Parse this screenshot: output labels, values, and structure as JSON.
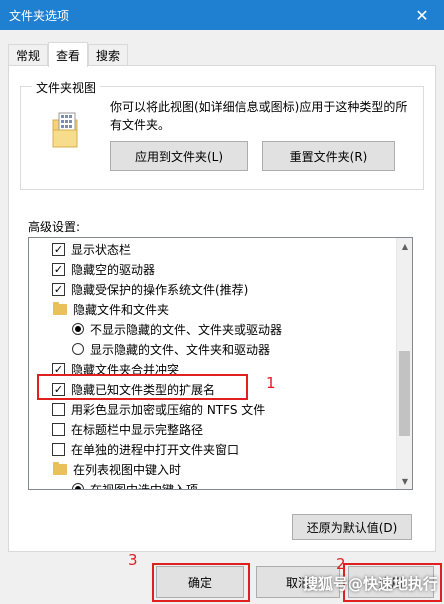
{
  "window": {
    "title": "文件夹选项",
    "close_symbol": "✕"
  },
  "tabs": [
    {
      "label": "常规",
      "active": false
    },
    {
      "label": "查看",
      "active": true
    },
    {
      "label": "搜索",
      "active": false
    }
  ],
  "folder_view": {
    "title": "文件夹视图",
    "description": "你可以将此视图(如详细信息或图标)应用于这种类型的所有文件夹。",
    "apply_button": "应用到文件夹(L)",
    "reset_button": "重置文件夹(R)"
  },
  "advanced": {
    "label": "高级设置:",
    "items": [
      {
        "type": "checkbox",
        "checked": true,
        "label": "显示状态栏"
      },
      {
        "type": "checkbox",
        "checked": true,
        "label": "隐藏空的驱动器"
      },
      {
        "type": "checkbox",
        "checked": true,
        "label": "隐藏受保护的操作系统文件(推荐)"
      },
      {
        "type": "folder",
        "label": "隐藏文件和文件夹"
      },
      {
        "type": "radio",
        "checked": true,
        "label": "不显示隐藏的文件、文件夹或驱动器"
      },
      {
        "type": "radio",
        "checked": false,
        "label": "显示隐藏的文件、文件夹和驱动器"
      },
      {
        "type": "checkbox",
        "checked": true,
        "label": "隐藏文件夹合并冲突"
      },
      {
        "type": "checkbox",
        "checked": true,
        "label": "隐藏已知文件类型的扩展名"
      },
      {
        "type": "checkbox",
        "checked": false,
        "label": "用彩色显示加密或压缩的 NTFS 文件"
      },
      {
        "type": "checkbox",
        "checked": false,
        "label": "在标题栏中显示完整路径"
      },
      {
        "type": "checkbox",
        "checked": false,
        "label": "在单独的进程中打开文件夹窗口"
      },
      {
        "type": "folder",
        "label": "在列表视图中键入时"
      },
      {
        "type": "radio",
        "checked": true,
        "label": "在视图中选中键入项"
      }
    ],
    "check_symbol": "✓",
    "restore_defaults_button": "还原为默认值(D)"
  },
  "footer": {
    "ok_button": "确定",
    "cancel_button": "取消",
    "apply_button": "应用"
  },
  "annotations": {
    "num1": "1",
    "num2": "2",
    "num3": "3"
  },
  "watermark": "搜狐号@快速地执行",
  "colors": {
    "titlebar": "#1f7fd1",
    "annotation_red": "#e02020",
    "folder": "#e8c15a"
  }
}
